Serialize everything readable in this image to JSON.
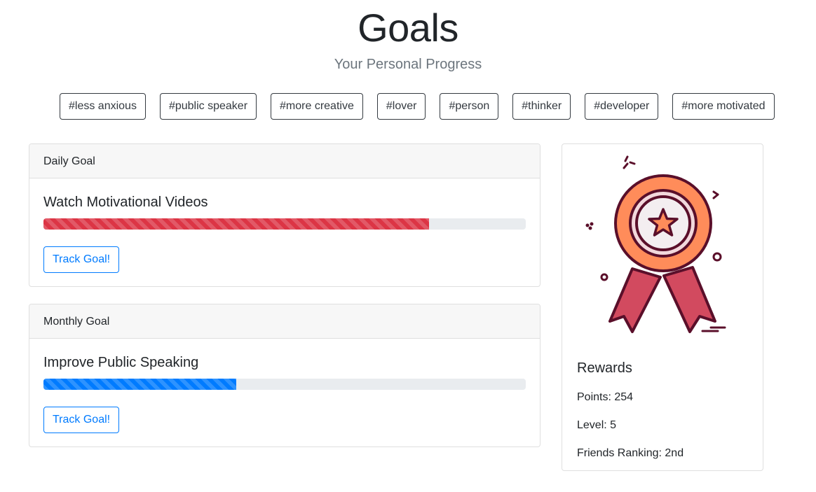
{
  "header": {
    "title": "Goals",
    "subtitle": "Your Personal Progress"
  },
  "tags": [
    "#less anxious",
    "#public speaker",
    "#more creative",
    "#lover",
    "#person",
    "#thinker",
    "#developer",
    "#more motivated"
  ],
  "daily": {
    "header": "Daily Goal",
    "title": "Watch Motivational Videos",
    "progress_percent": 80,
    "bar_color": "#dc3545",
    "button_label": "Track Goal!"
  },
  "monthly": {
    "header": "Monthly Goal",
    "title": "Improve Public Speaking",
    "progress_percent": 40,
    "bar_color": "#007bff",
    "button_label": "Track Goal!"
  },
  "rewards": {
    "icon": "award-ribbon-medal-icon",
    "title": "Rewards",
    "points": "Points: 254",
    "level": "Level: 5",
    "ranking": "Friends Ranking: 2nd"
  },
  "colors": {
    "accent_blue": "#007bff",
    "accent_red": "#dc3545",
    "medal_orange": "#ff8c5a",
    "ribbon_red": "#d24a5f",
    "outline_dark": "#5a0f2a"
  }
}
